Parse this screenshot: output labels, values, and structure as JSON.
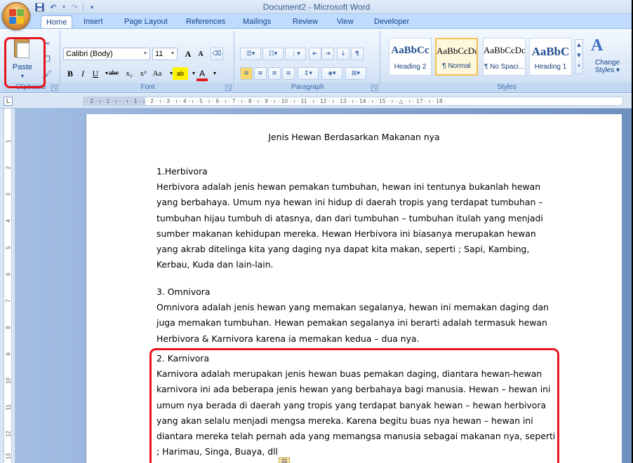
{
  "window": {
    "title": "Document2 - Microsoft Word"
  },
  "quick_access": {
    "save_icon": "save-icon",
    "undo_icon": "undo-icon",
    "redo_icon": "redo-icon",
    "customize_icon": "customize-icon"
  },
  "tabs": [
    "Home",
    "Insert",
    "Page Layout",
    "References",
    "Mailings",
    "Review",
    "View",
    "Developer"
  ],
  "ribbon": {
    "clipboard": {
      "paste_label": "Paste",
      "paste_arrow": "▾",
      "group_label": "Clipboard"
    },
    "font": {
      "font_name": "Calibri (Body)",
      "font_size": "11",
      "group_label": "Font",
      "bold": "B",
      "italic": "I",
      "underline": "U",
      "strike": "abe",
      "subscript": "x₂",
      "superscript": "x²",
      "change_case": "Aa",
      "grow": "A",
      "shrink": "A"
    },
    "paragraph": {
      "group_label": "Paragraph"
    },
    "styles": {
      "group_label": "Styles",
      "items": [
        {
          "sample": "AaBbCc",
          "name": "Heading 2"
        },
        {
          "sample": "AaBbCcDc",
          "name": "¶ Normal"
        },
        {
          "sample": "AaBbCcDc",
          "name": "¶ No Spaci..."
        },
        {
          "sample": "AaBbC",
          "name": "Heading 1"
        }
      ],
      "change_styles_line1": "Change",
      "change_styles_line2": "Styles ▾"
    }
  },
  "ruler": {
    "corner": "L",
    "ticks": "· 2 · ı · 1 · ı ·   · ı · 1 · ı · 2 · ı · 3 · ı · 4 · ı · 5 · ı · 6 · ı · 7 · ı · 8 · ı · 9 · ı · 10 · ı · 11 · ı · 12 · ı · 13 · ı · 14 · ı · 15 · ı · △ · ı · 17 · ı · 18 ·",
    "vertical_numbers": [
      "1",
      "2",
      "3",
      "4",
      "5",
      "6",
      "7",
      "8",
      "9",
      "10",
      "11",
      "12",
      "13"
    ]
  },
  "document": {
    "heading": "Jenis Hewan Berdasarkan Makanan nya",
    "sections": [
      {
        "title": "1.Herbivora",
        "body": "Herbivora adalah jenis hewan pemakan tumbuhan,  hewan ini tentunya bukanlah hewan yang berbahaya. Umum nya hewan ini hidup di daerah tropis yang terdapat tumbuhan – tumbuhan hijau tumbuh  di atasnya, dan dari tumbuhan – tumbuhan  itulah yang menjadi sumber makanan kehidupan mereka. Hewan Herbivora ini biasanya merupakan hewan yang akrab ditelinga kita yang daging nya dapat kita makan, seperti ; Sapi, Kambing, Kerbau, Kuda dan lain-lain."
      },
      {
        "title": "3. Omnivora",
        "body": "Omnivora adalah jenis hewan yang memakan segalanya, hewan ini memakan daging dan juga memakan tumbuhan.  Hewan pemakan segalanya ini berarti adalah termasuk hewan Herbivora & Karnivora karena ia memakan kedua – dua nya."
      },
      {
        "title": "2. Karnivora",
        "body": "Karnivora adalah merupakan jenis hewan buas  pemakan daging, diantara hewan-hewan karnivora ini ada beberapa jenis hewan yang berbahaya bagi manusia. Hewan – hewan ini umum nya berada di daerah yang tropis yang terdapat banyak hewan – hewan herbivora yang akan selalu menjadi mengsa mereka. Karena begitu buas nya hewan – hewan ini diantara mereka telah pernah ada yang memangsa manusia sebagai makanan nya, seperti ; Harimau, Singa, Buaya, dll"
      }
    ]
  },
  "colors": {
    "highlight": "#e8141b",
    "ribbon_blue": "#bfdbff",
    "workspace": "#6f8fbd"
  }
}
